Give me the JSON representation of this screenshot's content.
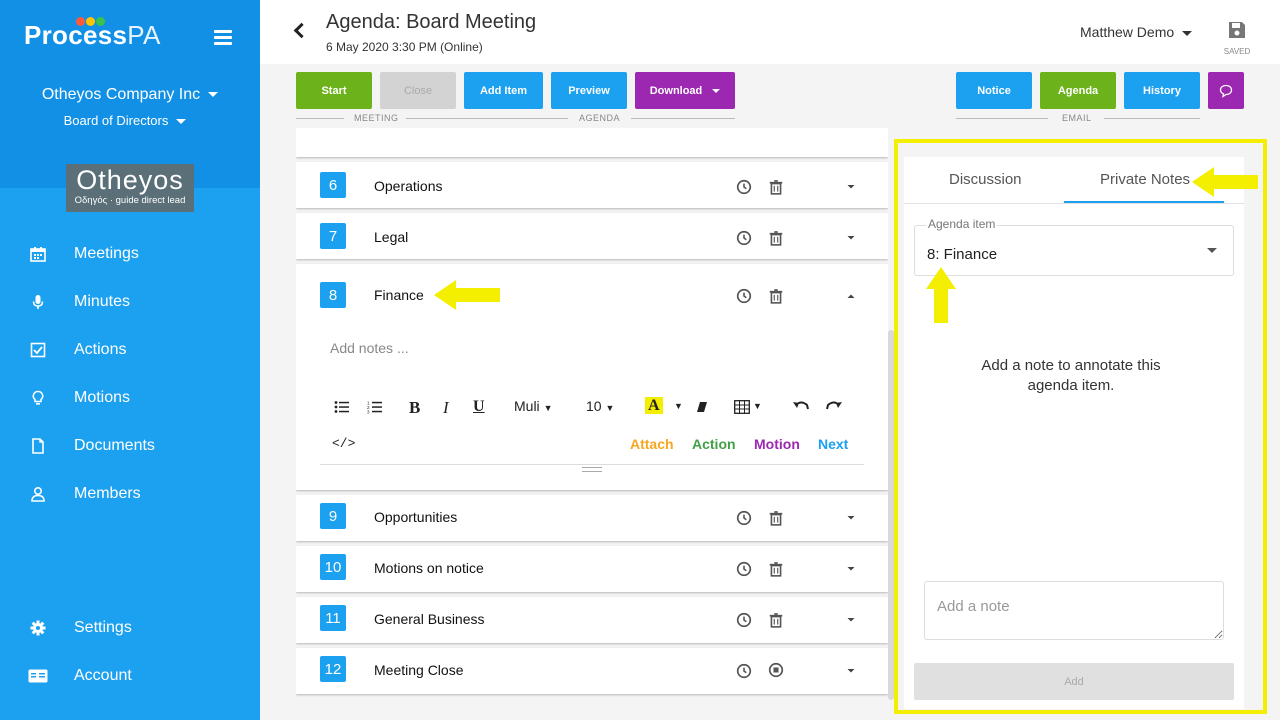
{
  "app": {
    "logo_main": "Process",
    "logo_accent": "PA",
    "dot_colors": [
      "#ff5a3c",
      "#ffc400",
      "#3ac24a",
      "#1ca0f0"
    ]
  },
  "sidebar": {
    "company": "Otheyos Company Inc",
    "board": "Board of Directors",
    "org_logo_big": "Otheyos",
    "org_logo_small": "Οδηγός · guide direct lead",
    "items": [
      {
        "label": "Meetings",
        "icon": "calendar-icon"
      },
      {
        "label": "Minutes",
        "icon": "microphone-icon"
      },
      {
        "label": "Actions",
        "icon": "checkbox-icon"
      },
      {
        "label": "Motions",
        "icon": "lightbulb-icon"
      },
      {
        "label": "Documents",
        "icon": "document-icon"
      },
      {
        "label": "Members",
        "icon": "person-icon"
      }
    ],
    "bottom_items": [
      {
        "label": "Settings",
        "icon": "gear-icon"
      },
      {
        "label": "Account",
        "icon": "id-card-icon"
      }
    ]
  },
  "header": {
    "title": "Agenda: Board Meeting",
    "subtitle": "6 May 2020 3:30 PM (Online)",
    "user": "Matthew Demo",
    "saved_label": "SAVED"
  },
  "toolbar": {
    "start": "Start",
    "close": "Close",
    "add_item": "Add Item",
    "preview": "Preview",
    "download": "Download",
    "notice": "Notice",
    "agenda": "Agenda",
    "history": "History",
    "group_meeting": "MEETING",
    "group_agenda": "AGENDA",
    "group_email": "EMAIL"
  },
  "colors": {
    "green": "#6cb21a",
    "blue": "#1ca0f0",
    "purple": "#9c27b0",
    "gray": "#d3d3d3",
    "highlight": "#f4ee00"
  },
  "agenda_items": [
    {
      "num": "6",
      "title": "Operations"
    },
    {
      "num": "7",
      "title": "Legal"
    },
    {
      "num": "8",
      "title": "Finance"
    },
    {
      "num": "9",
      "title": "Opportunities"
    },
    {
      "num": "10",
      "title": "Motions on notice"
    },
    {
      "num": "11",
      "title": "General Business"
    },
    {
      "num": "12",
      "title": "Meeting Close"
    }
  ],
  "editor": {
    "placeholder": "Add notes ...",
    "font": "Muli",
    "size": "10",
    "code": "</>",
    "bold": "B",
    "italic": "I",
    "underline": "U",
    "text_color": "A",
    "attach": "Attach",
    "action": "Action",
    "motion": "Motion",
    "next": "Next"
  },
  "panel": {
    "tab_discussion": "Discussion",
    "tab_private_notes": "Private Notes",
    "select_label": "Agenda item",
    "select_value": "8: Finance",
    "empty_message": "Add a note to annotate this agenda item.",
    "note_placeholder": "Add a note",
    "add_button": "Add"
  }
}
